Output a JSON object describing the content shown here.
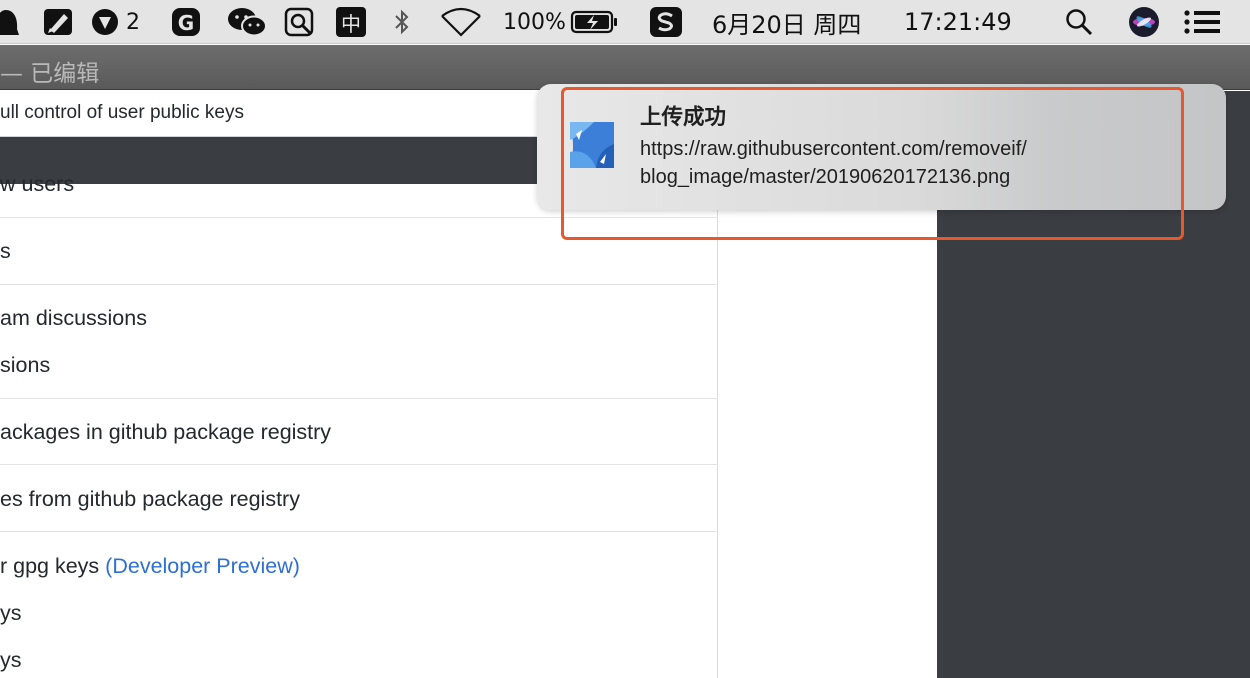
{
  "menubar": {
    "wechat_count": "2",
    "input_method": "中",
    "battery": "100%",
    "datetime": "6月20日 周四",
    "clock": "17:21:49",
    "icons": [
      "qq-icon",
      "pencil-app-icon",
      "shield-badge-icon",
      "g-app-icon",
      "wechat-icon",
      "screenshot-icon",
      "input-method-icon",
      "bluetooth-icon",
      "wifi-icon",
      "battery-icon",
      "sougou-icon",
      "search-icon",
      "siri-icon",
      "notification-center-icon"
    ]
  },
  "window": {
    "title": "— 已编辑"
  },
  "page": {
    "top_strip": "ull control of user public keys",
    "rows": {
      "r1": "w users",
      "r2": "s",
      "r3": "am discussions",
      "r4": "sions",
      "r5": "ackages in github package registry",
      "r6": "es from github package registry",
      "r7a": "r gpg keys",
      "r7b": "(Developer Preview)",
      "r8": "ys",
      "r9": "ys"
    }
  },
  "notification": {
    "title": "上传成功",
    "line1": "https://raw.githubusercontent.com/removeif/",
    "line2": "blog_image/master/20190620172136.png"
  },
  "colors": {
    "accent_link": "#2f6fd1",
    "highlight": "#e8582f",
    "dark_panel": "#3a3d42"
  }
}
